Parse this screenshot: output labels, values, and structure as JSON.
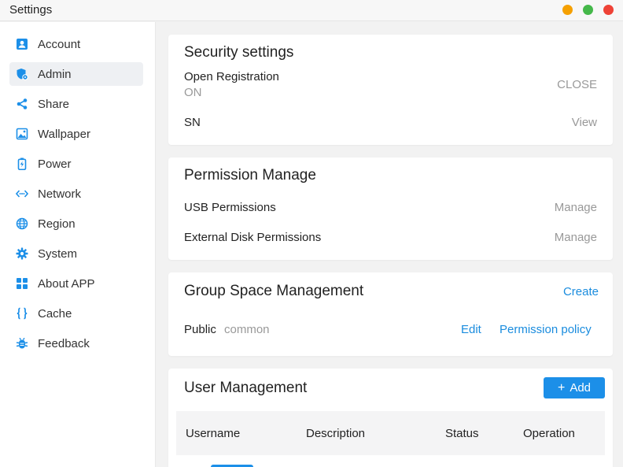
{
  "window": {
    "title": "Settings"
  },
  "sidebar": {
    "items": [
      {
        "label": "Account",
        "icon": "account-icon"
      },
      {
        "label": "Admin",
        "icon": "admin-shield-icon",
        "active": true
      },
      {
        "label": "Share",
        "icon": "share-icon"
      },
      {
        "label": "Wallpaper",
        "icon": "wallpaper-icon"
      },
      {
        "label": "Power",
        "icon": "battery-icon"
      },
      {
        "label": "Network",
        "icon": "network-icon"
      },
      {
        "label": "Region",
        "icon": "globe-icon"
      },
      {
        "label": "System",
        "icon": "gear-icon"
      },
      {
        "label": "About APP",
        "icon": "apps-grid-icon"
      },
      {
        "label": "Cache",
        "icon": "braces-icon"
      },
      {
        "label": "Feedback",
        "icon": "bug-icon"
      }
    ]
  },
  "security": {
    "title": "Security settings",
    "open_registration_label": "Open Registration",
    "open_registration_value": "ON",
    "open_registration_action": "CLOSE",
    "sn_label": "SN",
    "sn_action": "View"
  },
  "permission": {
    "title": "Permission Manage",
    "usb_label": "USB Permissions",
    "usb_action": "Manage",
    "disk_label": "External Disk Permissions",
    "disk_action": "Manage"
  },
  "group_space": {
    "title": "Group Space Management",
    "create_label": "Create",
    "group_name": "Public",
    "group_desc": "common",
    "edit_label": "Edit",
    "policy_label": "Permission policy"
  },
  "users": {
    "title": "User Management",
    "add_label": "Add",
    "columns": [
      "Username",
      "Description",
      "Status",
      "Operation"
    ]
  },
  "colors": {
    "accent": "#1c8fe8",
    "link": "#1a8cde",
    "window_min": "#f5a000",
    "window_max": "#45b84a",
    "window_close": "#ee4236"
  }
}
